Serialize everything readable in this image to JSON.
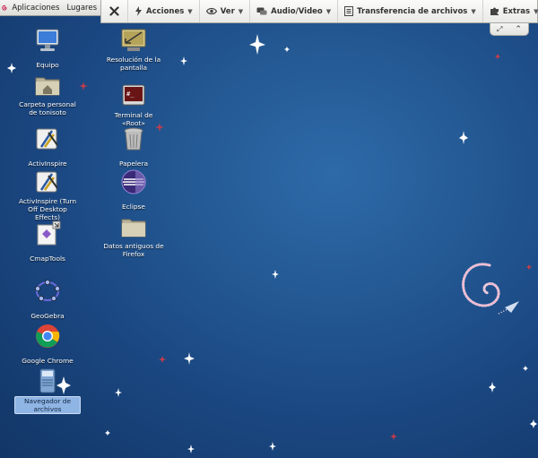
{
  "panel": {
    "menus": [
      "Aplicaciones",
      "Lugares"
    ]
  },
  "toolbar": {
    "items": [
      {
        "label": "Acciones",
        "icon": "lightning-icon"
      },
      {
        "label": "Ver",
        "icon": "eye-icon"
      },
      {
        "label": "Audio/Video",
        "icon": "chat-icon"
      },
      {
        "label": "Transferencia de archivos",
        "icon": "transfer-icon"
      },
      {
        "label": "Extras",
        "icon": "puzzle-icon"
      }
    ]
  },
  "desktop": {
    "icons": [
      {
        "label": "Equipo",
        "icon": "computer-icon"
      },
      {
        "label": "Carpeta personal de tonisoto",
        "icon": "home-folder-icon"
      },
      {
        "label": "ActivInspire",
        "icon": "activinspire-icon"
      },
      {
        "label": "ActivInspire (Turn Off Desktop Effects)",
        "icon": "activinspire-icon"
      },
      {
        "label": "CmapTools",
        "icon": "cmaptools-icon"
      },
      {
        "label": "GeoGebra",
        "icon": "geogebra-icon"
      },
      {
        "label": "Google Chrome",
        "icon": "chrome-icon"
      },
      {
        "label": "Navegador de archivos",
        "icon": "file-browser-icon",
        "selected": true
      },
      {
        "label": "Resolución de la pantalla",
        "icon": "display-settings-icon"
      },
      {
        "label": "Terminal de «Root»",
        "icon": "terminal-icon"
      },
      {
        "label": "Papelera",
        "icon": "trash-icon"
      },
      {
        "label": "Eclipse",
        "icon": "eclipse-icon"
      },
      {
        "label": "Datos antiguos de Firefox",
        "icon": "folder-icon"
      }
    ]
  },
  "colors": {
    "wallpaper": "#1f4e8c",
    "selection": "#8fb5e4"
  }
}
